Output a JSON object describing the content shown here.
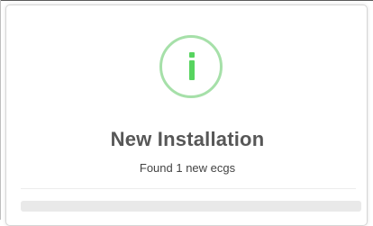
{
  "dialog": {
    "icon": "info-icon",
    "title": "New Installation",
    "message": "Found 1 new ecgs",
    "progress": 0,
    "colors": {
      "icon_ring": "#a6e0a9",
      "icon_glyph": "#57d45f",
      "title": "#575757",
      "progress_track": "#e9e9e9"
    }
  }
}
